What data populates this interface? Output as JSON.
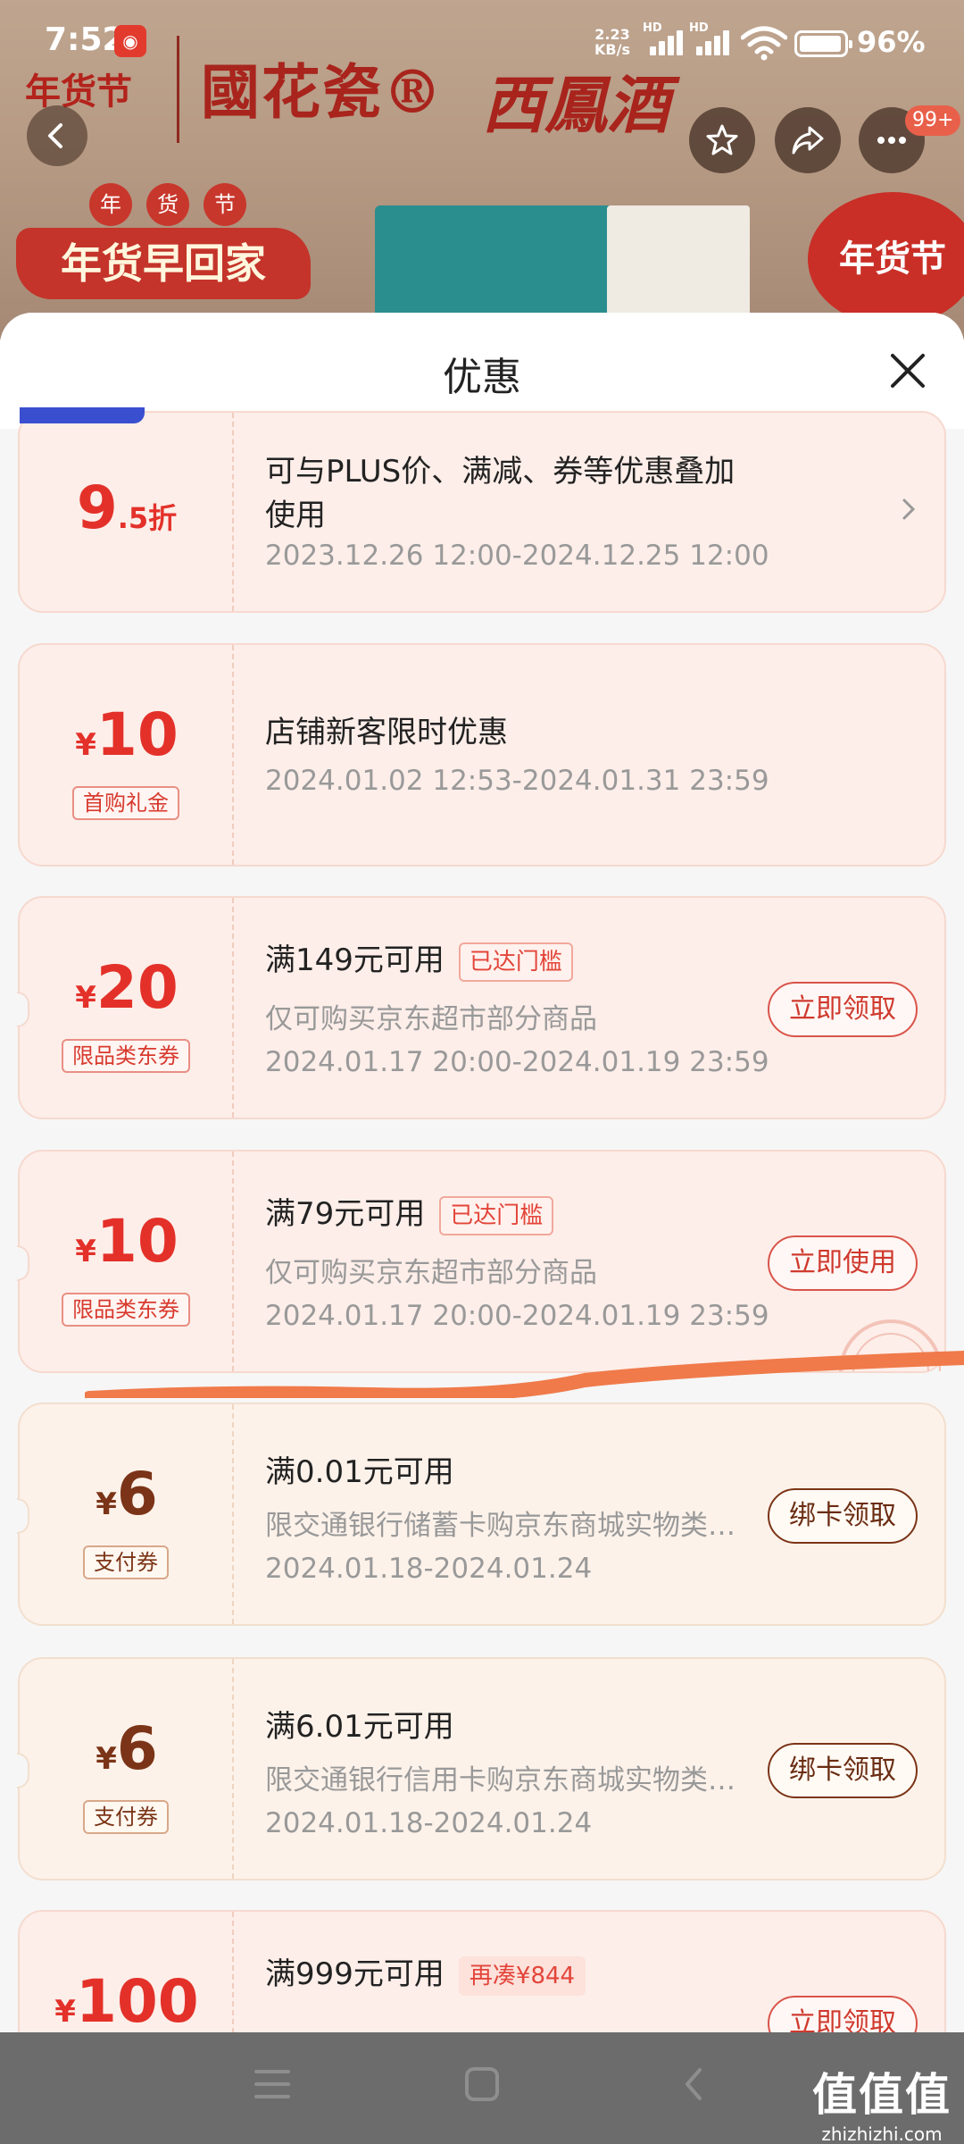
{
  "status_bar": {
    "time": "7:52",
    "net_speed_value": "2.23",
    "net_speed_unit": "KB/s",
    "signal_tag_1": "HD",
    "signal_tag_2": "HD",
    "battery": "96%"
  },
  "banner": {
    "brand_left": "年货节",
    "brand_main": "國花瓷®",
    "brand_second": "西鳳酒",
    "ribbon_top": [
      "年",
      "货",
      "节"
    ],
    "ribbon_text": "年货早回家",
    "badge_text": "年货节",
    "more_count": "99+"
  },
  "sheet": {
    "title": "优惠"
  },
  "coupons": [
    {
      "amount_prefix": "",
      "amount": "9",
      "amount_suffix": ".5折",
      "tag": "",
      "title": "可与PLUS价、满减、券等优惠叠加",
      "title_line2": "使用",
      "badge": "",
      "subtitle": "",
      "date": "2023.12.26 12:00-2024.12.25 12:00",
      "action": "",
      "kind": "discount"
    },
    {
      "amount_prefix": "¥",
      "amount": "10",
      "amount_suffix": "",
      "tag": "首购礼金",
      "title": "店铺新客限时优惠",
      "badge": "",
      "subtitle": "",
      "date": "2024.01.02 12:53-2024.01.31 23:59",
      "action": "",
      "kind": "cash"
    },
    {
      "amount_prefix": "¥",
      "amount": "20",
      "amount_suffix": "",
      "tag": "限品类东券",
      "title": "满149元可用",
      "badge": "已达门槛",
      "subtitle": "仅可购买京东超市部分商品",
      "date": "2024.01.17 20:00-2024.01.19 23:59",
      "action": "立即领取",
      "kind": "jd"
    },
    {
      "amount_prefix": "¥",
      "amount": "10",
      "amount_suffix": "",
      "tag": "限品类东券",
      "title": "满79元可用",
      "badge": "已达门槛",
      "subtitle": "仅可购买京东超市部分商品",
      "date": "2024.01.17 20:00-2024.01.19 23:59",
      "action": "立即使用",
      "kind": "jd"
    },
    {
      "amount_prefix": "¥",
      "amount": "6",
      "amount_suffix": "",
      "tag": "支付券",
      "title": "满0.01元可用",
      "badge": "",
      "subtitle": "限交通银行储蓄卡购京东商城实物类…",
      "date": "2024.01.18-2024.01.24",
      "action": "绑卡领取",
      "kind": "payment"
    },
    {
      "amount_prefix": "¥",
      "amount": "6",
      "amount_suffix": "",
      "tag": "支付券",
      "title": "满6.01元可用",
      "badge": "",
      "subtitle": "限交通银行信用卡购京东商城实物类…",
      "date": "2024.01.18-2024.01.24",
      "action": "绑卡领取",
      "kind": "payment"
    },
    {
      "amount_prefix": "¥",
      "amount": "100",
      "amount_suffix": "",
      "tag": "",
      "title": "满999元可用",
      "badge": "再凑¥844",
      "subtitle": "",
      "date": "",
      "action": "立即领取",
      "kind": "jd"
    }
  ],
  "watermark": {
    "main": "值值值",
    "sub": "zhizhizhi.com"
  },
  "colors": {
    "accent_red": "#e3312a",
    "payment_brown": "#7b3417",
    "card_bg": "#fdeee9",
    "annotation_orange": "#f07a4a"
  }
}
